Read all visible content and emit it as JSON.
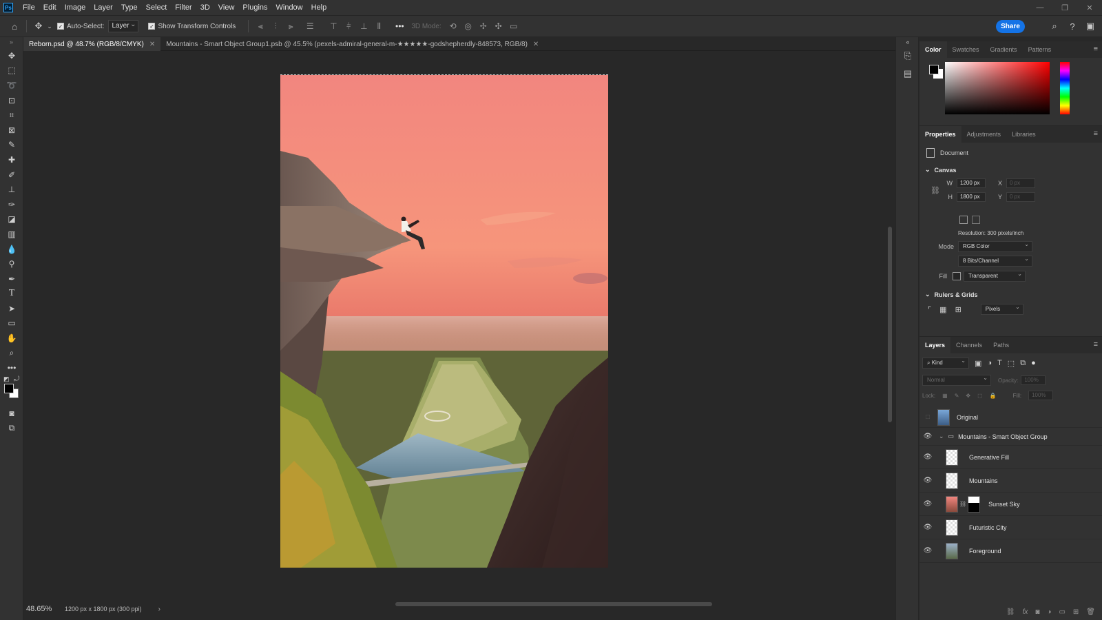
{
  "app": {
    "logo": "Ps",
    "menus": [
      "File",
      "Edit",
      "Image",
      "Layer",
      "Type",
      "Select",
      "Filter",
      "3D",
      "View",
      "Plugins",
      "Window",
      "Help"
    ]
  },
  "options_bar": {
    "auto_select_label": "Auto-Select:",
    "auto_select_value": "Layer",
    "transform_controls_label": "Show Transform Controls",
    "mode_label": "3D Mode:",
    "share_label": "Share"
  },
  "tabs": [
    {
      "label": "Reborn.psd @ 48.7% (RGB/8/CMYK)",
      "active": true
    },
    {
      "label": "Mountains - Smart Object Group1.psb @ 45.5% (pexels-admiral-general-m-★★★★★-godshepherdly-848573, RGB/8)",
      "active": false
    }
  ],
  "status": {
    "zoom": "48.65%",
    "doc_info": "1200 px x 1800 px (300 ppi)"
  },
  "color_panel": {
    "tabs": [
      "Color",
      "Swatches",
      "Gradients",
      "Patterns"
    ],
    "foreground": "#000000",
    "background": "#ffffff",
    "hue": "#ff0000"
  },
  "properties": {
    "tabs": [
      "Properties",
      "Adjustments",
      "Libraries"
    ],
    "doc_label": "Document",
    "canvas_header": "Canvas",
    "w_label": "W",
    "w_value": "1200 px",
    "h_label": "H",
    "h_value": "1800 px",
    "x_label": "X",
    "x_value": "0 px",
    "y_label": "Y",
    "y_value": "0 px",
    "resolution": "Resolution: 300 pixels/inch",
    "mode_label": "Mode",
    "mode_value": "RGB Color",
    "bits_value": "8 Bits/Channel",
    "fill_label": "Fill",
    "fill_value": "Transparent",
    "rulers_header": "Rulers & Grids",
    "units_value": "Pixels"
  },
  "layers_panel": {
    "tabs": [
      "Layers",
      "Channels",
      "Paths"
    ],
    "filter_kind": "Kind",
    "blend_mode": "Normal",
    "opacity_label": "Opacity:",
    "opacity_value": "100%",
    "lock_label": "Lock:",
    "fill_label": "Fill:",
    "fill_value": "100%",
    "layers": [
      {
        "name": "Original",
        "visible": false,
        "kind": "image"
      },
      {
        "name": "Mountains - Smart Object Group",
        "visible": true,
        "kind": "group"
      },
      {
        "name": "Generative Fill",
        "visible": true,
        "kind": "transparent"
      },
      {
        "name": "Mountains",
        "visible": true,
        "kind": "transparent"
      },
      {
        "name": "Sunset Sky",
        "visible": true,
        "kind": "masked"
      },
      {
        "name": "Futuristic City",
        "visible": true,
        "kind": "transparent"
      },
      {
        "name": "Foreground",
        "visible": true,
        "kind": "image"
      }
    ]
  }
}
